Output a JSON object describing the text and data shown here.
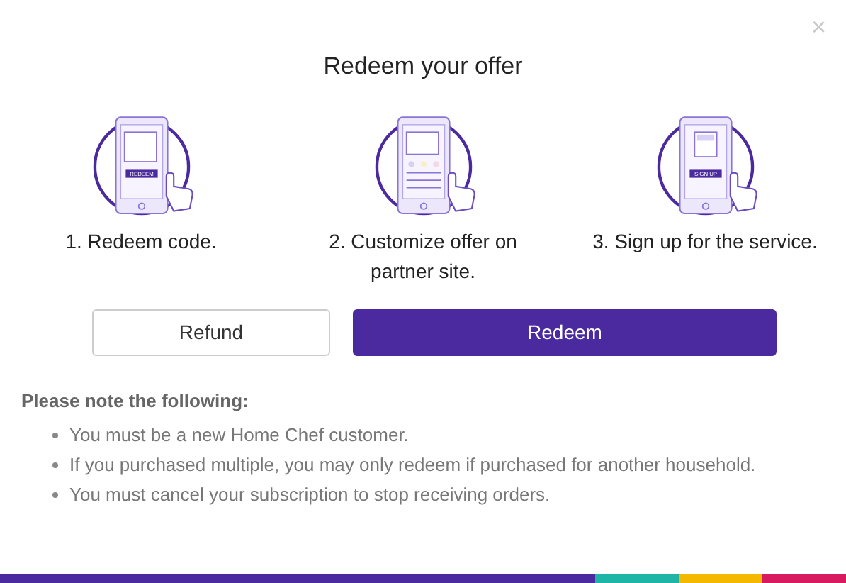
{
  "dialog": {
    "title": "Redeem your offer",
    "close": "×"
  },
  "steps": [
    {
      "kind": "redeem",
      "screen_label": "REDEEM",
      "text": "1. Redeem code."
    },
    {
      "kind": "customize",
      "text": "2. Customize offer on partner site."
    },
    {
      "kind": "signup",
      "screen_label": "SIGN UP",
      "text": "3. Sign up for the service."
    }
  ],
  "buttons": [
    {
      "label": "Refund",
      "kind": "secondary"
    },
    {
      "label": "Redeem",
      "kind": "primary"
    }
  ],
  "notes": {
    "heading": "Please note the following:",
    "items": [
      "You must be a new Home Chef customer.",
      "If you purchased multiple, you may only redeem if purchased for another household.",
      "You must cancel your subscription to stop receiving orders."
    ]
  },
  "footer_stripes": [
    {
      "color": "#4a2a9e"
    },
    {
      "color": "#1fb5a6"
    },
    {
      "color": "#f5b800"
    },
    {
      "color": "#d81b60"
    }
  ]
}
